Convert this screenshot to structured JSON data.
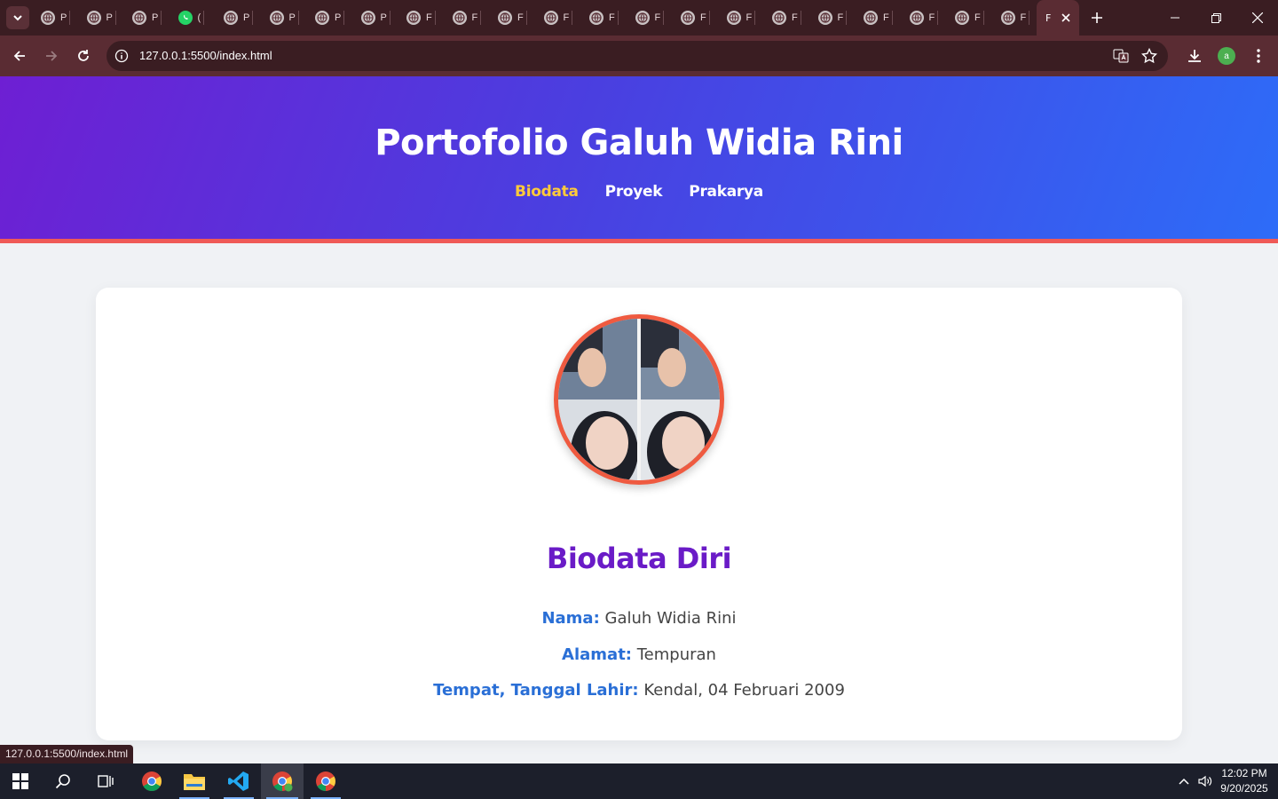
{
  "browser": {
    "tabs": [
      {
        "icon": "globe-icon",
        "label": "P"
      },
      {
        "icon": "globe-icon",
        "label": "P"
      },
      {
        "icon": "globe-icon",
        "label": "P"
      },
      {
        "icon": "whatsapp-icon",
        "label": "("
      },
      {
        "icon": "globe-icon",
        "label": "P"
      },
      {
        "icon": "globe-icon",
        "label": "P"
      },
      {
        "icon": "globe-icon",
        "label": "P"
      },
      {
        "icon": "globe-icon",
        "label": "P"
      },
      {
        "icon": "globe-icon",
        "label": "F"
      },
      {
        "icon": "globe-icon",
        "label": "F"
      },
      {
        "icon": "globe-icon",
        "label": "F"
      },
      {
        "icon": "globe-icon",
        "label": "F"
      },
      {
        "icon": "globe-icon",
        "label": "F"
      },
      {
        "icon": "globe-icon",
        "label": "F"
      },
      {
        "icon": "globe-icon",
        "label": "F"
      },
      {
        "icon": "globe-icon",
        "label": "F"
      },
      {
        "icon": "globe-icon",
        "label": "F"
      },
      {
        "icon": "globe-icon",
        "label": "F"
      },
      {
        "icon": "globe-icon",
        "label": "F"
      },
      {
        "icon": "globe-icon",
        "label": "F"
      },
      {
        "icon": "globe-icon",
        "label": "F"
      },
      {
        "icon": "globe-icon",
        "label": "F"
      }
    ],
    "active_tab_label": "F",
    "url": "127.0.0.1:5500/index.html",
    "profile_initial": "a",
    "status_url": "127.0.0.1:5500/index.html"
  },
  "site": {
    "title": "Portofolio Galuh Widia Rini",
    "nav": [
      {
        "label": "Biodata",
        "active": true
      },
      {
        "label": "Proyek",
        "active": false
      },
      {
        "label": "Prakarya",
        "active": false
      }
    ]
  },
  "biodata": {
    "heading": "Biodata Diri",
    "rows": [
      {
        "label": "Nama:",
        "value": "Galuh Widia Rini"
      },
      {
        "label": "Alamat:",
        "value": "Tempuran"
      },
      {
        "label": "Tempat, Tanggal Lahir:",
        "value": "Kendal, 04 Februari 2009"
      }
    ]
  },
  "taskbar": {
    "time": "12:02 PM",
    "date": "9/20/2025"
  },
  "colors": {
    "header_gradient_start": "#6e1fd3",
    "header_gradient_end": "#2d6cf8",
    "header_border": "#ef5a57",
    "nav_active": "#ffcb3a",
    "heading": "#6a1bc7",
    "label": "#2a6fd6"
  }
}
